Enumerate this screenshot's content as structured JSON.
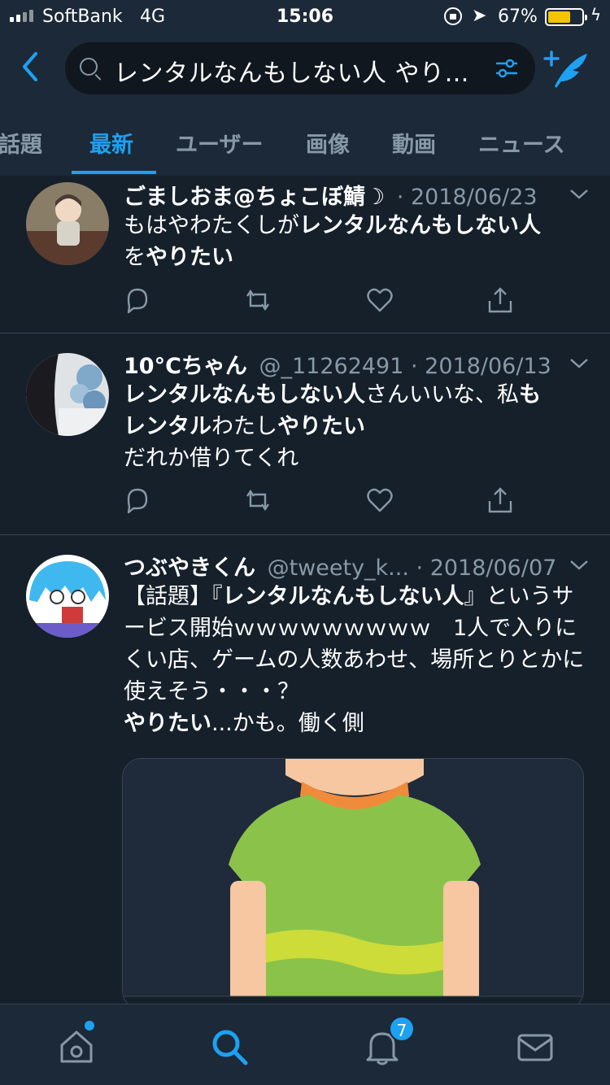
{
  "status_bar": {
    "carrier": "SoftBank",
    "network": "4G",
    "time": "15:06",
    "battery_percent": "67%",
    "battery_level": 0.67
  },
  "search": {
    "query": "レンタルなんもしない人 やり…"
  },
  "tabs": [
    {
      "label": "話題"
    },
    {
      "label": "最新"
    },
    {
      "label": "ユーザー"
    },
    {
      "label": "画像"
    },
    {
      "label": "動画"
    },
    {
      "label": "ニュース"
    }
  ],
  "active_tab": "最新",
  "tweets": [
    {
      "name": "ごましおま@ちょこぼ鯖☽",
      "handle": "",
      "date": "· 2018/06/23",
      "text_parts": [
        {
          "t": "もはやわたくしが",
          "b": false
        },
        {
          "t": "レンタルなんもしない人",
          "b": true
        },
        {
          "t": "を",
          "b": false
        },
        {
          "t": "やりたい",
          "b": true
        }
      ]
    },
    {
      "name": "10°Cちゃん",
      "handle": "@_11262491",
      "date": "· 2018/06/13",
      "text_parts": [
        {
          "t": "レンタルなんもしない人",
          "b": true
        },
        {
          "t": "さんいいな、私",
          "b": false
        },
        {
          "t": "も",
          "b": true
        },
        {
          "t": "レンタル",
          "b": true
        },
        {
          "t": "わたし",
          "b": false
        },
        {
          "t": "やりたい",
          "b": true
        },
        {
          "t": "だれか借りてくれ",
          "b": false
        }
      ]
    },
    {
      "name": "つぶやきくん",
      "handle": "@tweety_k...",
      "date": "· 2018/06/07",
      "text_parts": [
        {
          "t": "【話題】『",
          "b": false
        },
        {
          "t": "レンタルなんもしない人",
          "b": true
        },
        {
          "t": "』というサービス開始ｗｗｗｗｗｗｗｗｗ　1人で入りにくい店、ゲームの人数あわせ、場所とりとかに使えそう・・・？",
          "b": false
        },
        {
          "t": "やりたい",
          "b": true
        },
        {
          "t": "...かも。働く側",
          "b": false
        }
      ]
    }
  ],
  "bottom_nav": {
    "notifications_badge": "7"
  },
  "colors": {
    "accent": "#1da1f2",
    "background": "#15202b",
    "bar": "#1c2938",
    "muted": "#8899a6"
  }
}
